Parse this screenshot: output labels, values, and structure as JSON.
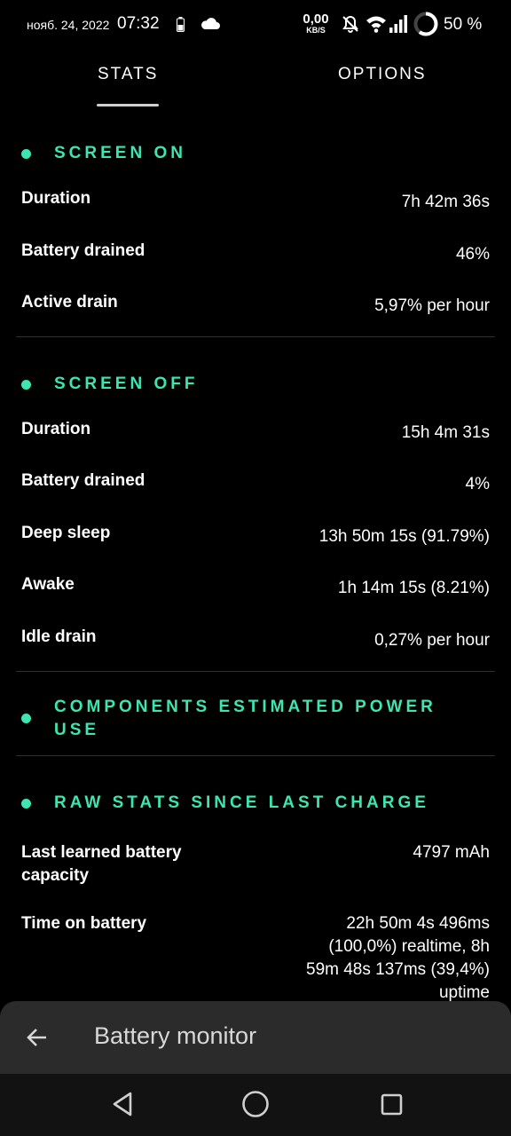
{
  "status_bar": {
    "date": "нояб. 24, 2022",
    "time": "07:32",
    "net_speed_value": "0,00",
    "net_speed_unit": "KB/S",
    "battery_percent": "50 %",
    "icons": [
      "battery-small-icon",
      "cloud-icon",
      "mute-icon",
      "wifi-icon",
      "signal-icon",
      "battery-ring-icon"
    ]
  },
  "tabs": [
    {
      "label": "STATS",
      "selected": true
    },
    {
      "label": "OPTIONS",
      "selected": false
    }
  ],
  "sections": {
    "screen_on": {
      "title": "SCREEN ON",
      "rows": [
        {
          "label": "Duration",
          "value": "7h 42m 36s"
        },
        {
          "label": "Battery drained",
          "value": "46%"
        },
        {
          "label": "Active drain",
          "value": "5,97% per hour"
        }
      ]
    },
    "screen_off": {
      "title": "SCREEN OFF",
      "rows": [
        {
          "label": "Duration",
          "value": "15h 4m 31s"
        },
        {
          "label": "Battery drained",
          "value": "4%"
        },
        {
          "label": "Deep sleep",
          "value": "13h 50m 15s  (91.79%)"
        },
        {
          "label": "Awake",
          "value": "1h 14m 15s  (8.21%)"
        },
        {
          "label": "Idle drain",
          "value": "0,27% per hour"
        }
      ]
    },
    "components": {
      "title_line1": "COMPONENTS ESTIMATED POWER",
      "title_line2": "USE"
    },
    "raw_stats": {
      "title": "RAW STATS SINCE LAST CHARGE",
      "capacity_label_line1": "Last learned battery",
      "capacity_label_line2": "capacity",
      "capacity_value": "4797 mAh",
      "time_label": "Time on battery",
      "time_value_lines": [
        "22h 50m 4s 496ms",
        "(100,0%) realtime, 8h",
        "59m 48s 137ms (39,4%)",
        "uptime"
      ]
    }
  },
  "bottom_sheet": {
    "title": "Battery monitor",
    "back_icon": "arrow-left-icon"
  },
  "nav_bar": {
    "icons": [
      "nav-back-icon",
      "nav-home-icon",
      "nav-recents-icon"
    ]
  },
  "colors": {
    "accent": "#3be6b1",
    "background": "#000000",
    "sheet": "#2b2b2b",
    "nav": "#121212"
  }
}
